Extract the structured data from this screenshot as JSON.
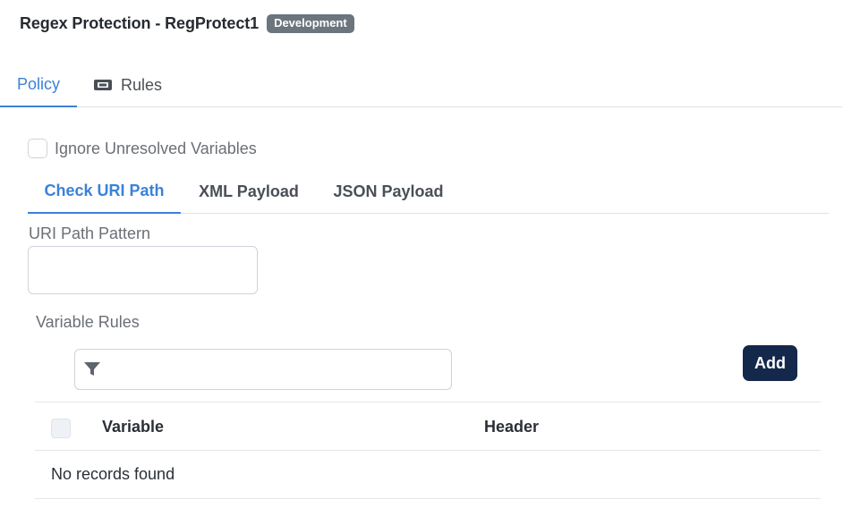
{
  "header": {
    "title": "Regex Protection - RegProtect1",
    "badge": "Development"
  },
  "main_tabs": [
    {
      "label": "Policy",
      "active": true
    },
    {
      "label": "Rules",
      "active": false,
      "icon": "ticket-icon"
    }
  ],
  "options": {
    "ignore_unresolved_label": "Ignore Unresolved Variables",
    "ignore_unresolved_checked": false
  },
  "sub_tabs": [
    {
      "label": "Check URI Path",
      "active": true
    },
    {
      "label": "XML Payload",
      "active": false
    },
    {
      "label": "JSON Payload",
      "active": false
    }
  ],
  "uri_path": {
    "label": "URI Path Pattern",
    "value": ""
  },
  "variable_rules": {
    "label": "Variable Rules",
    "filter_value": "",
    "add_label": "Add",
    "columns": [
      "Variable",
      "Header"
    ],
    "empty_message": "No records found"
  },
  "colors": {
    "accent": "#3b82d6",
    "badge_bg": "#6c757d",
    "primary_button": "#14284b"
  }
}
